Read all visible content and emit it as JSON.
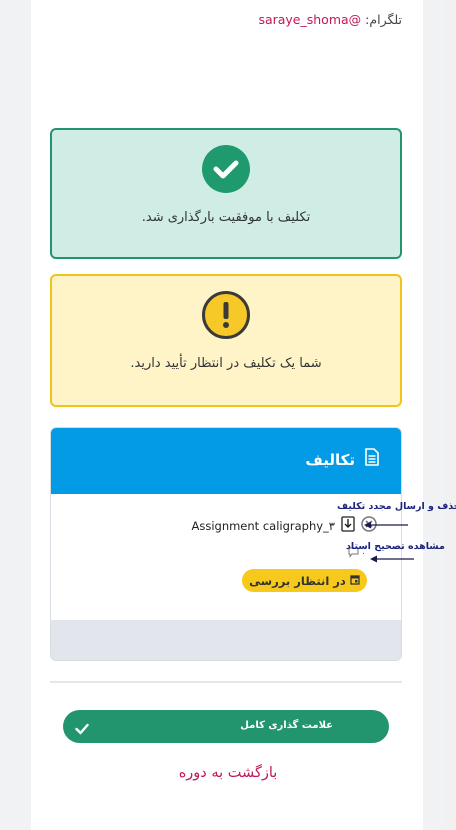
{
  "telegram": {
    "label": "تلگرام:",
    "handle": "@saraye_shoma"
  },
  "alerts": {
    "success": {
      "message": "تکلیف با موفقیت بارگذاری شد.",
      "icon": "check-icon",
      "color": "#1f9a6e"
    },
    "warning": {
      "message": "شما یک تکلیف در انتظار تأیید دارید.",
      "icon": "exclamation-icon",
      "color": "#f7c928"
    }
  },
  "assignments": {
    "title": "تکالیف",
    "header_color": "#039be5",
    "file_name": "Assignment caligraphy_۳",
    "comment_count": "۰",
    "status_label": "در انتظار بررسی"
  },
  "annotations": {
    "delete_resend": "حذف و ارسال مجدد تکلیف",
    "view_correction": "مشاهده تصحیح استاد"
  },
  "complete_button": {
    "label": "علامت گذاری کامل"
  },
  "back_link": {
    "label": "بازگشت به دوره"
  }
}
